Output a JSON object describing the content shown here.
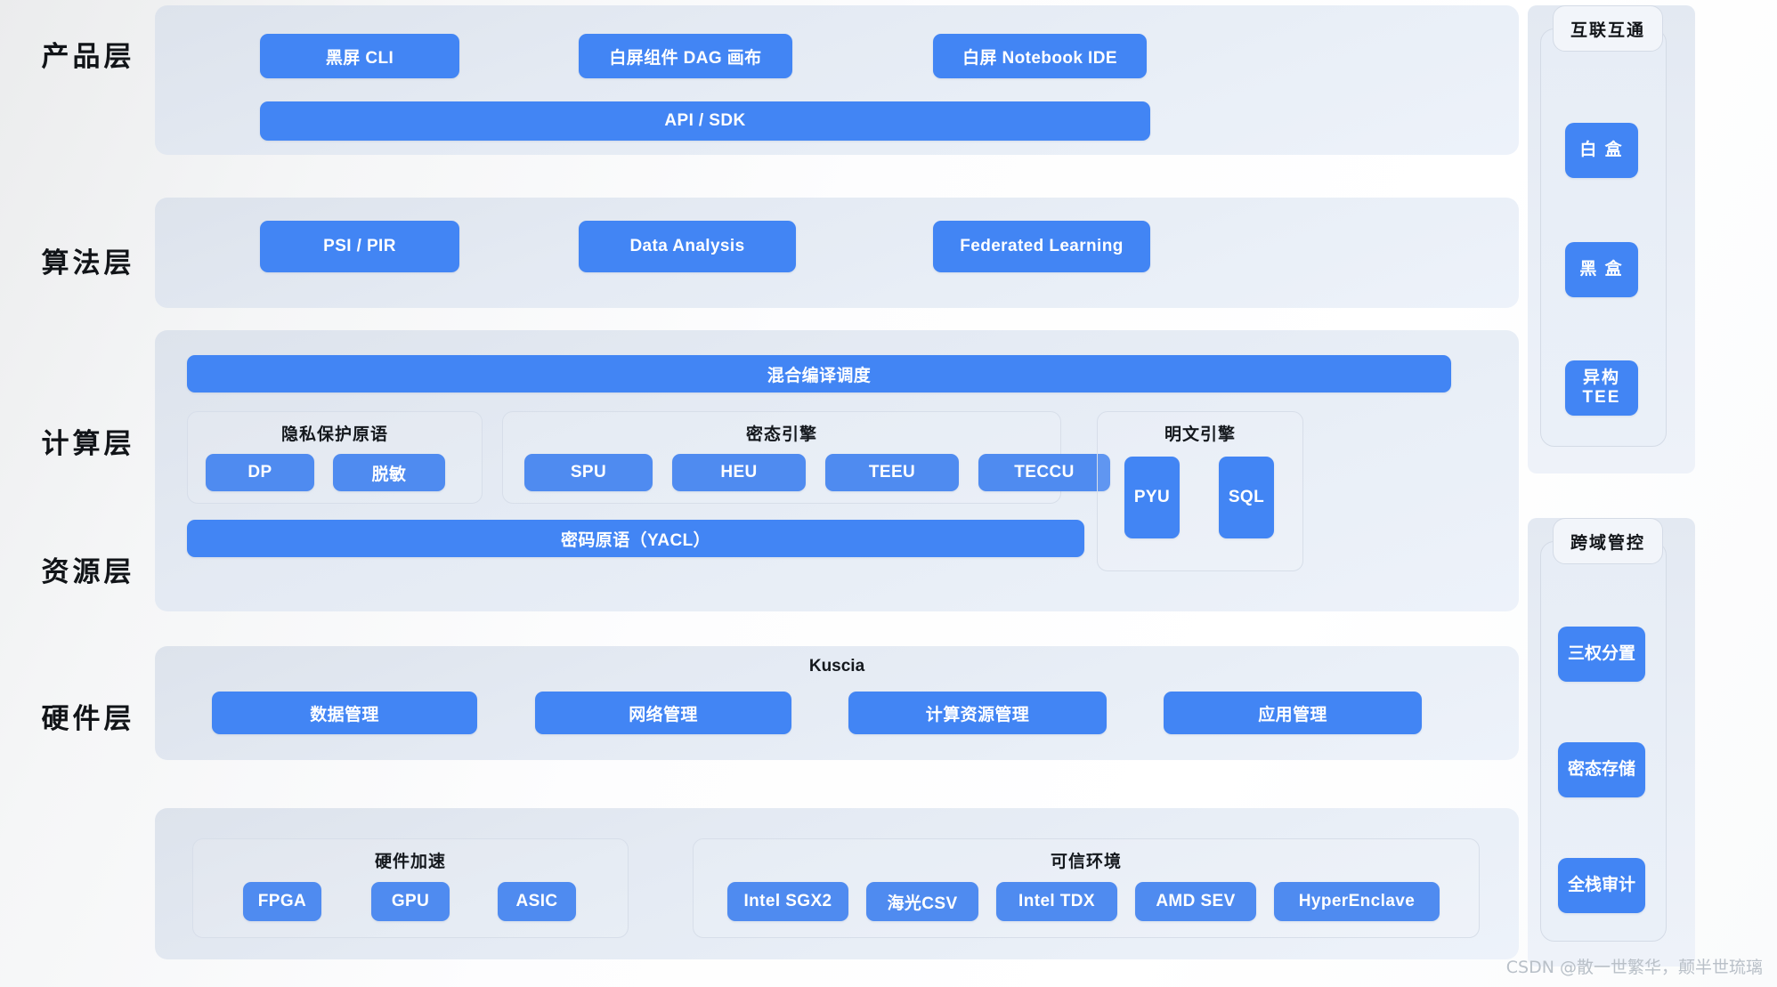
{
  "layers": [
    {
      "id": "product",
      "label": "产品层",
      "products": [
        "黑屏 CLI",
        "白屏组件 DAG 画布",
        "白屏 Notebook IDE"
      ],
      "api_bar": "API / SDK"
    },
    {
      "id": "algorithm",
      "label": "算法层",
      "items": [
        "PSI / PIR",
        "Data Analysis",
        "Federated Learning"
      ]
    },
    {
      "id": "compute",
      "label": "计算层",
      "top_bar": "混合编译调度",
      "bottom_bar": "密码原语（YACL）",
      "groups": [
        {
          "title": "隐私保护原语",
          "items": [
            "DP",
            "脱敏"
          ]
        },
        {
          "title": "密态引擎",
          "items": [
            "SPU",
            "HEU",
            "TEEU",
            "TECCU"
          ]
        },
        {
          "title": "明文引擎",
          "items": [
            "PYU",
            "SQL"
          ]
        }
      ]
    },
    {
      "id": "resource",
      "label": "资源层",
      "title": "Kuscia",
      "items": [
        "数据管理",
        "网络管理",
        "计算资源管理",
        "应用管理"
      ]
    },
    {
      "id": "hardware",
      "label": "硬件层",
      "groups": [
        {
          "title": "硬件加速",
          "items": [
            "FPGA",
            "GPU",
            "ASIC"
          ]
        },
        {
          "title": "可信环境",
          "items": [
            "Intel SGX2",
            "海光CSV",
            "Intel TDX",
            "AMD SEV",
            "HyperEnclave"
          ]
        }
      ]
    }
  ],
  "side_panels": [
    {
      "id": "interop",
      "title": "互联互通",
      "items": [
        "白 盒",
        "黑 盒",
        "异构\nTEE"
      ]
    },
    {
      "id": "cross-domain-control",
      "title": "跨域管控",
      "items": [
        "三权分置",
        "密态存储",
        "全栈审计"
      ]
    }
  ],
  "watermark": "CSDN @散一世繁华，颠半世琉璃",
  "colors": {
    "accent": "#4285f4",
    "accent_light": "#4f8bf0",
    "panel": "#e7edf6",
    "text": "#111418"
  }
}
